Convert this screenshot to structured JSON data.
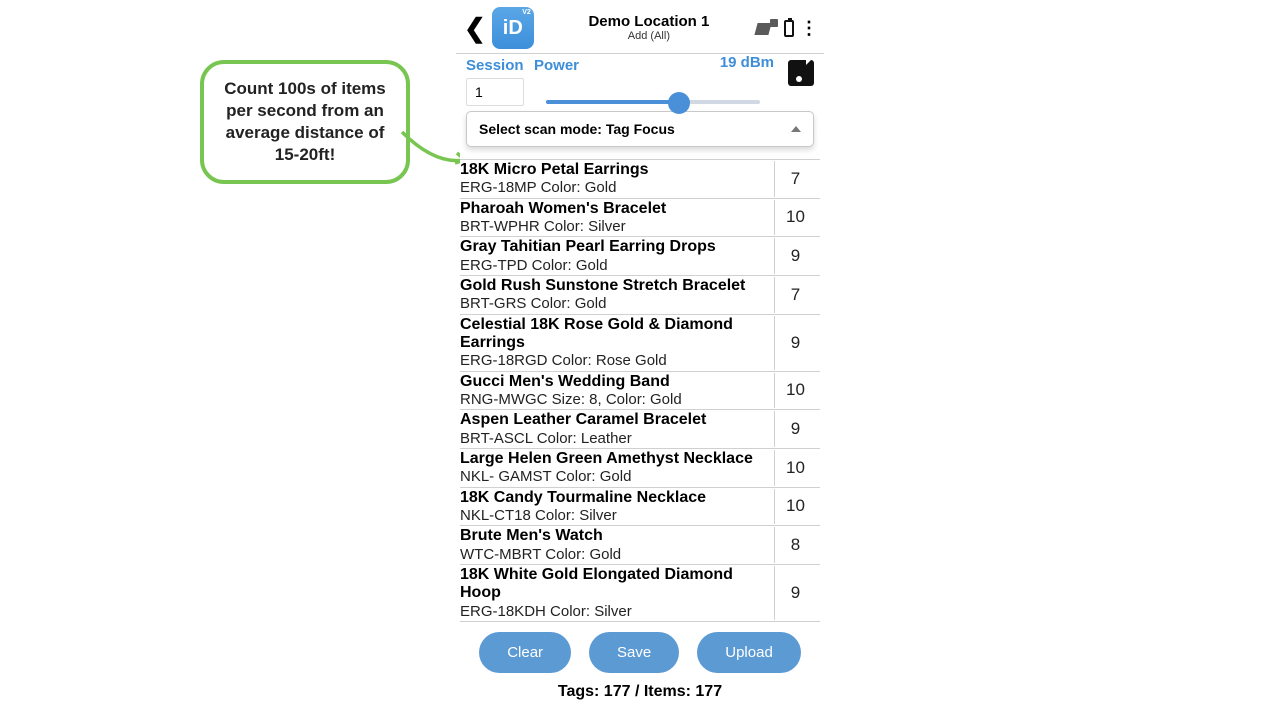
{
  "header": {
    "title": "Demo Location 1",
    "subtitle": "Add (All)"
  },
  "controls": {
    "session_label": "Session",
    "session_value": "1",
    "power_label": "Power",
    "power_value": "19 dBm",
    "slider_pct": 60
  },
  "scan_mode": {
    "label_prefix": "Select scan mode:  ",
    "selected": "Tag Focus"
  },
  "items": [
    {
      "name": "18K Micro Petal Earrings",
      "meta": "ERG-18MP Color: Gold",
      "count": 7
    },
    {
      "name": "Pharoah Women's Bracelet",
      "meta": "BRT-WPHR Color: Silver",
      "count": 10
    },
    {
      "name": "Gray Tahitian Pearl Earring Drops",
      "meta": "ERG-TPD Color: Gold",
      "count": 9
    },
    {
      "name": "Gold Rush Sunstone Stretch Bracelet",
      "meta": "BRT-GRS Color: Gold",
      "count": 7
    },
    {
      "name": "Celestial 18K Rose Gold & Diamond Earrings",
      "meta": "ERG-18RGD Color: Rose Gold",
      "count": 9
    },
    {
      "name": "Gucci Men's Wedding Band",
      "meta": "RNG-MWGC Size: 8, Color: Gold",
      "count": 10
    },
    {
      "name": "Aspen Leather Caramel Bracelet",
      "meta": "BRT-ASCL Color: Leather",
      "count": 9
    },
    {
      "name": "Large Helen Green Amethyst Necklace",
      "meta": "NKL- GAMST Color: Gold",
      "count": 10
    },
    {
      "name": "18K Candy Tourmaline Necklace",
      "meta": "NKL-CT18 Color: Silver",
      "count": 10
    },
    {
      "name": "Brute Men's Watch",
      "meta": "WTC-MBRT Color: Gold",
      "count": 8
    },
    {
      "name": "18K White Gold Elongated Diamond Hoop",
      "meta": "ERG-18KDH Color: Silver",
      "count": 9
    }
  ],
  "buttons": {
    "clear": "Clear",
    "save": "Save",
    "upload": "Upload"
  },
  "summary": "Tags: 177 / Items: 177",
  "callout": "Count 100s of items per second from an average distance of 15-20ft!"
}
